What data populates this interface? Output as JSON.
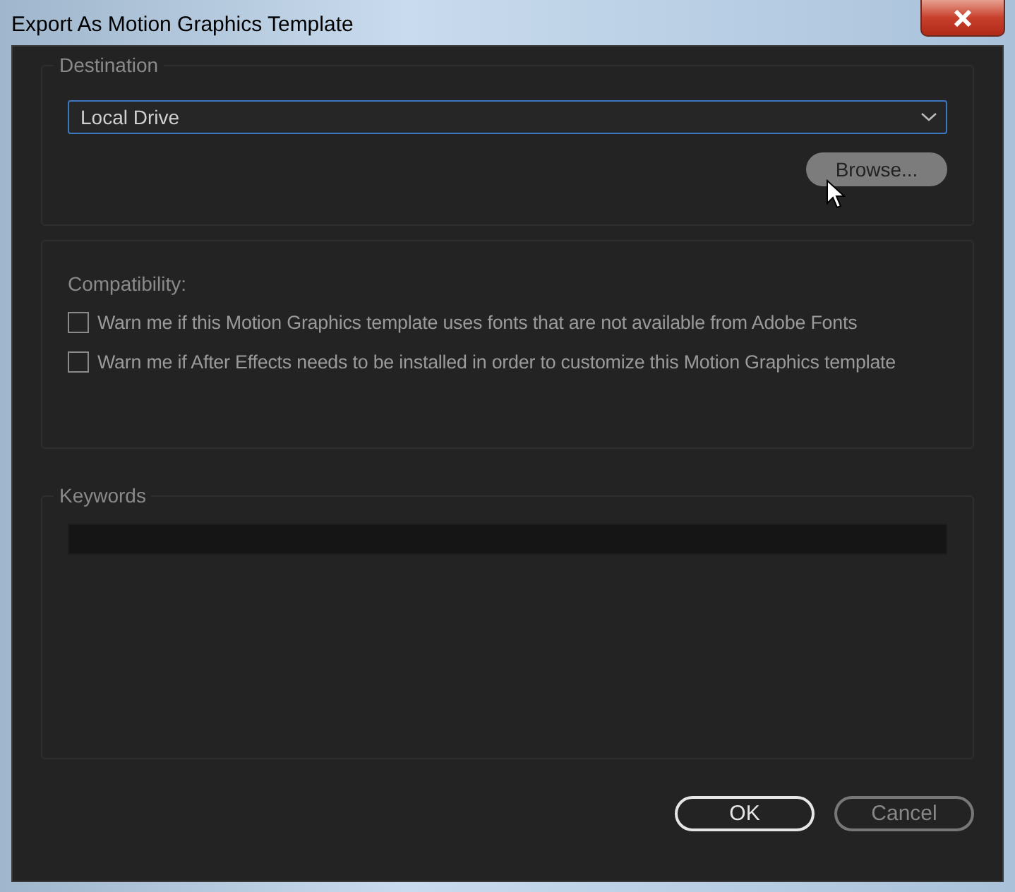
{
  "window": {
    "title": "Export As Motion Graphics Template"
  },
  "destination": {
    "label": "Destination",
    "value": "Local Drive",
    "browse": "Browse..."
  },
  "compatibility": {
    "label": "Compatibility:",
    "options": [
      {
        "label": "Warn me if this Motion Graphics template uses fonts that are not available from Adobe Fonts",
        "checked": false
      },
      {
        "label": "Warn me if After Effects needs to be installed in order to customize this Motion Graphics template",
        "checked": false
      }
    ]
  },
  "keywords": {
    "label": "Keywords"
  },
  "buttons": [
    {
      "label": "OK",
      "default": true
    },
    {
      "label": "Cancel",
      "default": false
    }
  ]
}
